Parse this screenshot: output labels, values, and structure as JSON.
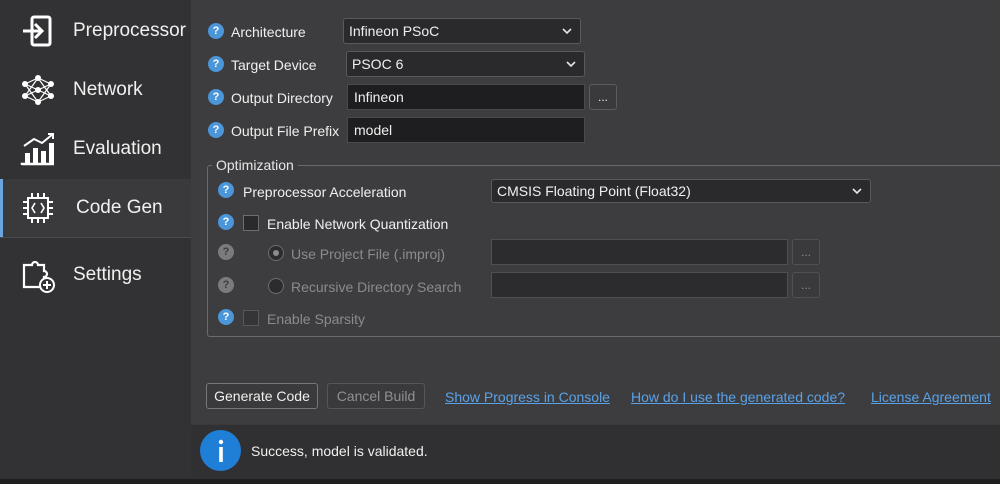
{
  "sidebar": {
    "items": [
      {
        "label": "Preprocessor",
        "icon": "import-arrow-icon",
        "active": false
      },
      {
        "label": "Network",
        "icon": "neural-network-icon",
        "active": false
      },
      {
        "label": "Evaluation",
        "icon": "bar-chart-icon",
        "active": false
      },
      {
        "label": "Code Gen",
        "icon": "chip-code-icon",
        "active": true
      },
      {
        "label": "Settings",
        "icon": "puzzle-settings-icon",
        "active": false
      }
    ],
    "accent_color": "#6aa5e0"
  },
  "form": {
    "architecture": {
      "label": "Architecture",
      "value": "Infineon PSoC"
    },
    "target_device": {
      "label": "Target Device",
      "value": "PSOC 6"
    },
    "output_directory": {
      "label": "Output Directory",
      "value": "Infineon",
      "browse_label": "..."
    },
    "output_prefix": {
      "label": "Output File Prefix",
      "value": "model"
    }
  },
  "optimization": {
    "title": "Optimization",
    "preprocessor_acceleration": {
      "label": "Preprocessor Acceleration",
      "value": "CMSIS Floating Point (Float32)"
    },
    "enable_quantization": {
      "label": "Enable Network Quantization",
      "checked": false
    },
    "use_project_file": {
      "label": "Use Project File (.improj)",
      "selected": true,
      "enabled": false,
      "value": "",
      "browse_label": "..."
    },
    "recursive_search": {
      "label": "Recursive Directory Search",
      "selected": false,
      "enabled": false,
      "value": "",
      "browse_label": "..."
    },
    "enable_sparsity": {
      "label": "Enable Sparsity",
      "checked": false,
      "enabled": false
    }
  },
  "actions": {
    "generate": "Generate Code",
    "cancel": "Cancel Build",
    "links": [
      "Show Progress in Console",
      "How do I use the generated code?",
      "License Agreement"
    ]
  },
  "status": {
    "message": "Success, model is validated.",
    "icon": "info-icon",
    "icon_glyph": "i",
    "icon_color": "#1f7ed6"
  },
  "help_glyph": "?"
}
